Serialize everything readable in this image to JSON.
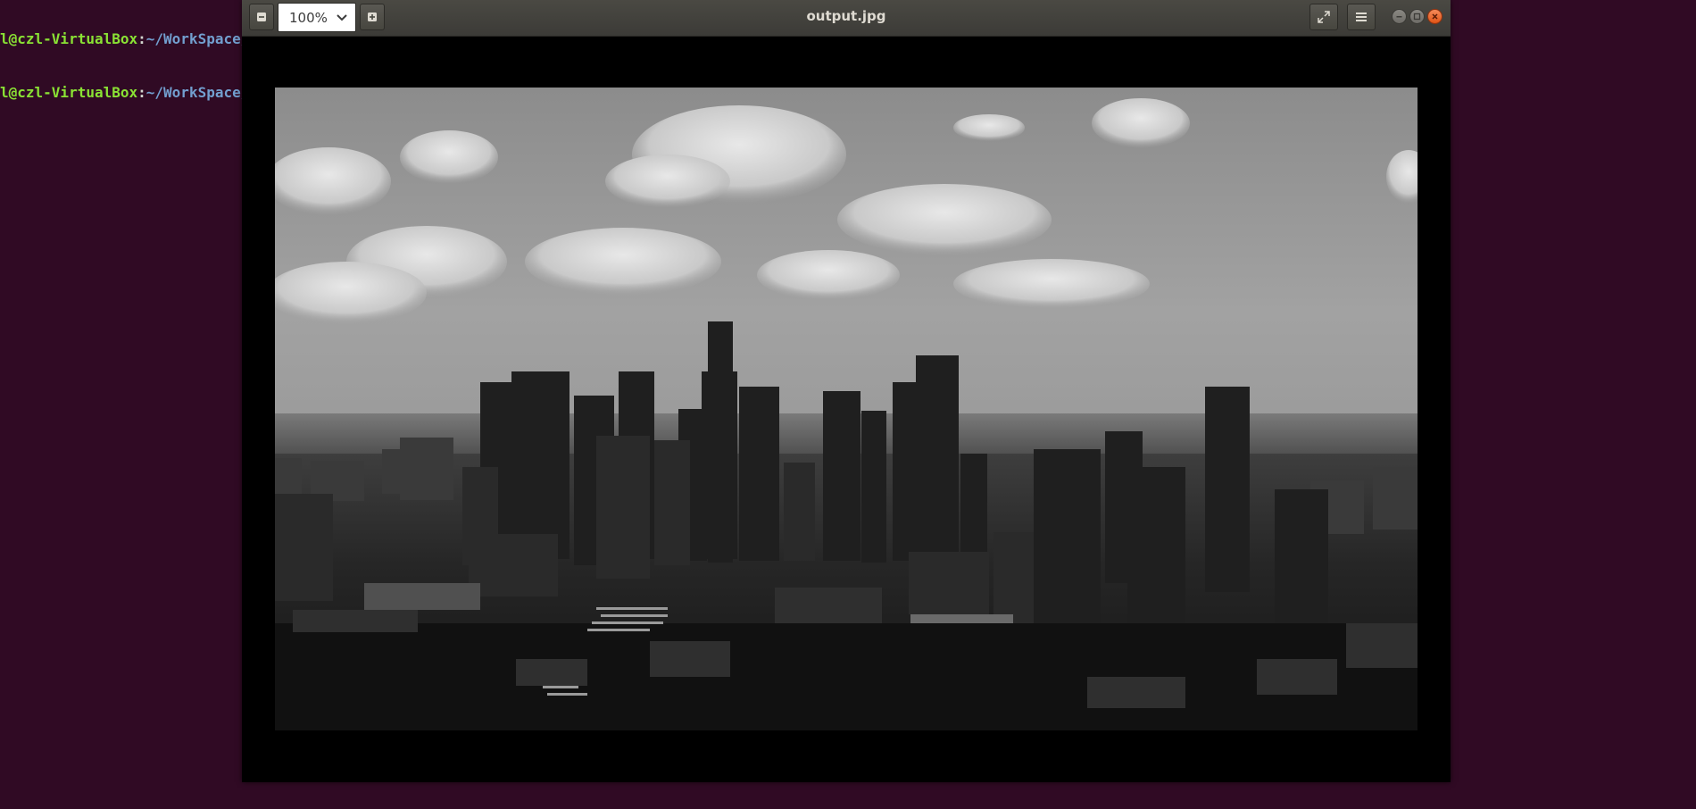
{
  "terminal": {
    "lines": [
      {
        "user": "l@czl-VirtualBox",
        "sep": ":",
        "path": "~/WorkSpace/f"
      },
      {
        "user": "l@czl-VirtualBox",
        "sep": ":",
        "path": "~/WorkSpace/f"
      }
    ]
  },
  "viewer": {
    "title": "output.jpg",
    "zoom": "100%",
    "icons": {
      "zoom_out": "minus-icon",
      "zoom_in": "plus-icon",
      "zoom_dropdown": "chevron-down-icon",
      "fullscreen": "fullscreen-icon",
      "menu": "hamburger-menu-icon",
      "minimize": "minimize-icon",
      "maximize": "maximize-icon",
      "close": "close-icon"
    },
    "image": {
      "description_tag": "grayscale-city-skyline-photo"
    }
  },
  "colors": {
    "desktop": "#300a24",
    "close": "#e05416",
    "titlebar": "#3c3b37"
  }
}
